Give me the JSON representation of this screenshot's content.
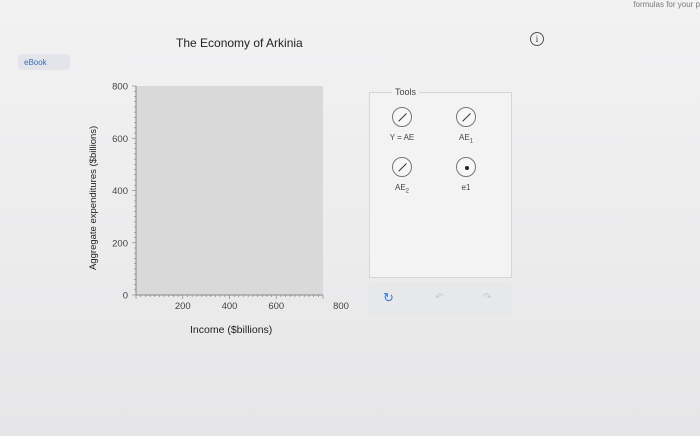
{
  "header": {
    "ebook_label": "eBook",
    "top_right_fragment": "formulas for your p",
    "info_icon": "info-icon"
  },
  "graph": {
    "title": "The Economy of Arkinia",
    "ylabel": "Aggregate expenditures ($billions)",
    "xlabel": "Income ($billions)",
    "y_ticks": [
      "0",
      "200",
      "400",
      "600",
      "800"
    ],
    "x_ticks": [
      "200",
      "400",
      "600",
      "800"
    ],
    "xlim": [
      0,
      800
    ],
    "ylim": [
      0,
      800
    ]
  },
  "tools": {
    "title": "Tools",
    "items": [
      {
        "name": "Y = AE",
        "icon": "line-tool-icon"
      },
      {
        "name": "AE",
        "sub": "1",
        "icon": "line-tool-icon"
      },
      {
        "name": "AE",
        "sub": "2",
        "icon": "line-tool-icon"
      },
      {
        "name": "e1",
        "icon": "point-tool-icon"
      }
    ]
  },
  "actions": {
    "undo_icon": "refresh-icon",
    "back_icon": "undo-arrow-icon",
    "forward_icon": "redo-arrow-icon"
  },
  "colors": {
    "plot_bg": "#d9d9da",
    "accent": "#3b7ad8"
  }
}
